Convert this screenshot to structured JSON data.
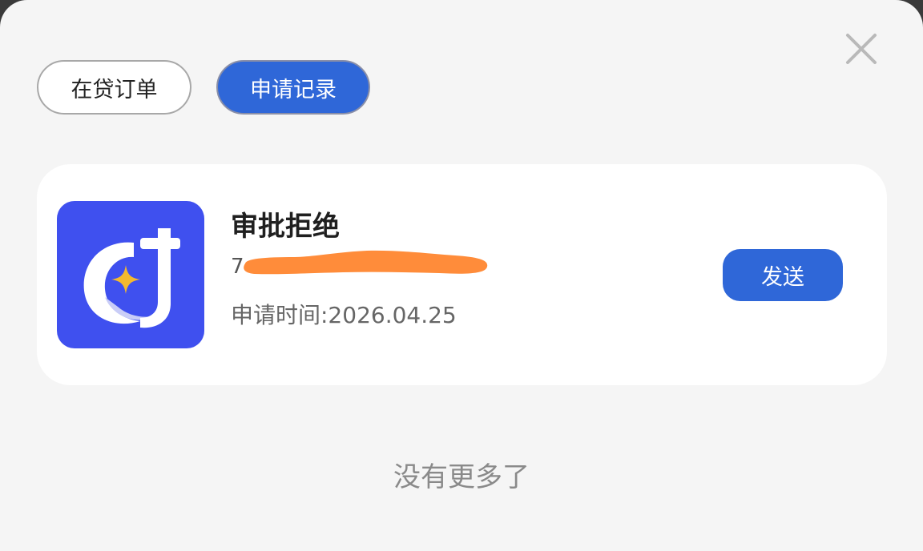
{
  "tabs": {
    "in_loan_orders": "在贷订单",
    "application_records": "申请记录",
    "active": "application_records"
  },
  "record": {
    "status": "审批拒绝",
    "order_number_visible": "7",
    "apply_time": "申请时间:2026.04.25",
    "send_label": "发送"
  },
  "footer": {
    "no_more": "没有更多了"
  },
  "icons": {
    "close": "close-icon",
    "app": "app-logo-icon"
  },
  "colors": {
    "accent": "#2f67d8",
    "logo_bg": "#3f50ef",
    "logo_star": "#f4b92e",
    "redaction": "#ff8c3a",
    "sheet_bg": "#f5f5f5"
  }
}
